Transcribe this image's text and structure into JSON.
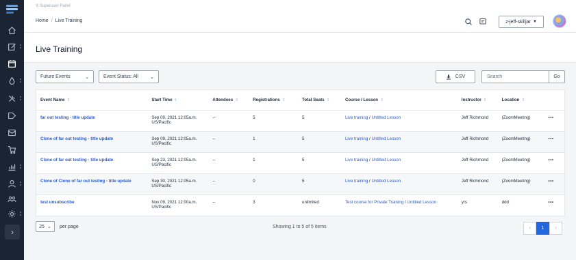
{
  "topbar": {
    "panel_label": "⚲ Superuser Panel",
    "breadcrumb": [
      "Home",
      "Live Training"
    ],
    "user": "z-jeff-skilljar"
  },
  "page": {
    "title": "Live Training"
  },
  "filters": {
    "events": "Future Events",
    "status": "Event Status: All",
    "csv": "CSV",
    "search_placeholder": "Search",
    "go": "Go"
  },
  "table": {
    "columns": [
      "Event Name",
      "Start Time",
      "Attendees",
      "Registrations",
      "Total Seats",
      "Course / Lesson",
      "Instructor",
      "Location"
    ],
    "rows": [
      {
        "event": "far out testing - title update",
        "start": "Sep 09, 2021 12:05a.m.",
        "tz": "US/Pacific",
        "attendees": "--",
        "registrations": "5",
        "seats": "5",
        "course": "Live training",
        "lesson": "Untitled Lesson",
        "instructor": "Jeff Richmond",
        "location": "(ZoomMeeting)",
        "more": "•••"
      },
      {
        "event": "Clone of far out testing - title update",
        "start": "Sep 09, 2021 12:05a.m.",
        "tz": "US/Pacific",
        "attendees": "--",
        "registrations": "1",
        "seats": "5",
        "course": "Live training",
        "lesson": "Untitled Lesson",
        "instructor": "Jeff Richmond",
        "location": "(ZoomMeeting)",
        "more": "•••"
      },
      {
        "event": "Clone of far out testing - title update",
        "start": "Sep 23, 2021 12:05a.m.",
        "tz": "US/Pacific",
        "attendees": "--",
        "registrations": "1",
        "seats": "5",
        "course": "Live training",
        "lesson": "Untitled Lesson",
        "instructor": "Jeff Richmond",
        "location": "(ZoomMeeting)",
        "more": "•••"
      },
      {
        "event": "Clone of Clone of far out testing - title update",
        "start": "Sep 30, 2021 12:05a.m.",
        "tz": "US/Pacific",
        "attendees": "--",
        "registrations": "0",
        "seats": "5",
        "course": "Live training",
        "lesson": "Untitled Lesson",
        "instructor": "Jeff Richmond",
        "location": "(ZoomMeeting)",
        "more": "•••"
      },
      {
        "event": "test unsubscribe",
        "start": "Nov 09, 2021 12:00a.m.",
        "tz": "US/Pacific",
        "attendees": "--",
        "registrations": "3",
        "seats": "unlimited",
        "course": "Test course for Private Training",
        "lesson": "Untitled Lesson",
        "instructor": "yrs",
        "location": "ddd",
        "more": "•••"
      }
    ]
  },
  "footer": {
    "per_page_value": "25",
    "per_page_label": "per page",
    "showing": "Showing 1 to 5 of 5 items",
    "prev": "‹",
    "current_page": "1",
    "next": "›"
  },
  "colors": {
    "sidebar": "#1b2433",
    "link": "#2a5bd7",
    "accent": "#2266e0"
  },
  "icons": [
    "home-icon",
    "edit-icon",
    "calendar-icon",
    "drop-icon",
    "tools-icon",
    "tag-icon",
    "mail-icon",
    "cart-icon",
    "chart-icon",
    "user-icon",
    "group-icon",
    "settings-icon",
    "search-icon",
    "chat-icon",
    "download-icon"
  ]
}
